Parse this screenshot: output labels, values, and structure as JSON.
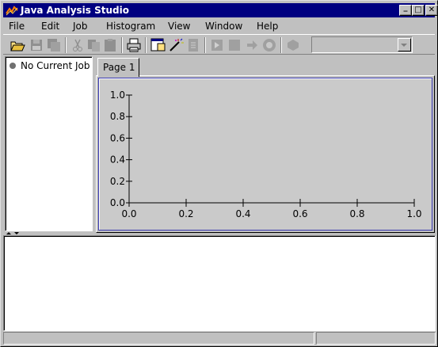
{
  "window": {
    "title": "Java Analysis Studio",
    "icon": "jas-logo-icon"
  },
  "title_buttons": {
    "minimize": "_",
    "maximize": "□",
    "close": "✕"
  },
  "menu": [
    {
      "label": "File",
      "mnemonic": "F"
    },
    {
      "label": "Edit",
      "mnemonic": "E"
    },
    {
      "label": "Job",
      "mnemonic": "J"
    },
    {
      "label": "Histogram",
      "mnemonic": "H"
    },
    {
      "label": "View",
      "mnemonic": "V"
    },
    {
      "label": "Window",
      "mnemonic": "W"
    },
    {
      "label": "Help",
      "mnemonic": "H"
    }
  ],
  "toolbar": {
    "buttons": [
      {
        "icon": "open-folder-icon",
        "enabled": true
      },
      {
        "icon": "save-icon",
        "enabled": false
      },
      {
        "icon": "save-all-icon",
        "enabled": false
      },
      {
        "icon": "cut-icon",
        "enabled": false
      },
      {
        "icon": "copy-icon",
        "enabled": false
      },
      {
        "icon": "paste-icon",
        "enabled": false
      },
      {
        "icon": "print-icon",
        "enabled": true
      },
      {
        "icon": "new-page-icon",
        "enabled": true
      },
      {
        "icon": "wizard-wand-icon",
        "enabled": true
      },
      {
        "icon": "document-icon",
        "enabled": false
      },
      {
        "icon": "run-job-icon",
        "enabled": false
      },
      {
        "icon": "stop-job-icon",
        "enabled": false
      },
      {
        "icon": "step-forward-icon",
        "enabled": false
      },
      {
        "icon": "go-icon",
        "enabled": false
      },
      {
        "icon": "rewind-icon",
        "enabled": false
      }
    ],
    "combo_value": ""
  },
  "tree": {
    "items": [
      {
        "label": "No Current Job",
        "icon": "job-status-dot-icon"
      }
    ]
  },
  "tabs": [
    {
      "label": "Page 1",
      "selected": true
    }
  ],
  "chart_data": {
    "type": "line",
    "title": "",
    "xlabel": "",
    "ylabel": "",
    "xlim": [
      0.0,
      1.0
    ],
    "ylim": [
      0.0,
      1.0
    ],
    "x_ticks": [
      "0.0",
      "0.2",
      "0.4",
      "0.6",
      "0.8",
      "1.0"
    ],
    "y_ticks": [
      "0.0",
      "0.2",
      "0.4",
      "0.6",
      "0.8",
      "1.0"
    ],
    "series": [],
    "grid": false
  },
  "console": {
    "text": ""
  },
  "status": {
    "left": "",
    "right": ""
  },
  "colors": {
    "title_bar": "#000080",
    "plot_border": "#3a3ab0",
    "face": "#c0c0c0"
  }
}
